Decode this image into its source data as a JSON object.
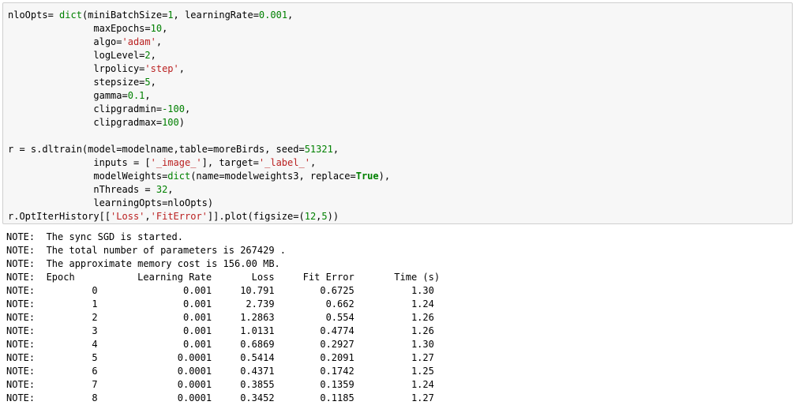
{
  "code_lines": [
    [
      {
        "t": "nloOpts= "
      },
      {
        "t": "dict",
        "c": "tok-builtin"
      },
      {
        "t": "(miniBatchSize="
      },
      {
        "t": "1",
        "c": "tok-num"
      },
      {
        "t": ", learningRate="
      },
      {
        "t": "0.001",
        "c": "tok-num"
      },
      {
        "t": ","
      }
    ],
    [
      {
        "t": "               maxEpochs="
      },
      {
        "t": "10",
        "c": "tok-num"
      },
      {
        "t": ","
      }
    ],
    [
      {
        "t": "               algo="
      },
      {
        "t": "'adam'",
        "c": "tok-str"
      },
      {
        "t": ","
      }
    ],
    [
      {
        "t": "               logLevel="
      },
      {
        "t": "2",
        "c": "tok-num"
      },
      {
        "t": ","
      }
    ],
    [
      {
        "t": "               lrpolicy="
      },
      {
        "t": "'step'",
        "c": "tok-str"
      },
      {
        "t": ","
      }
    ],
    [
      {
        "t": "               stepsize="
      },
      {
        "t": "5",
        "c": "tok-num"
      },
      {
        "t": ","
      }
    ],
    [
      {
        "t": "               gamma="
      },
      {
        "t": "0.1",
        "c": "tok-num"
      },
      {
        "t": ","
      }
    ],
    [
      {
        "t": "               clipgradmin="
      },
      {
        "t": "-100",
        "c": "tok-num"
      },
      {
        "t": ","
      }
    ],
    [
      {
        "t": "               clipgradmax="
      },
      {
        "t": "100",
        "c": "tok-num"
      },
      {
        "t": ")"
      }
    ],
    [
      {
        "t": ""
      }
    ],
    [
      {
        "t": "r = s.dltrain(model=modelname,table=moreBirds, seed="
      },
      {
        "t": "51321",
        "c": "tok-num"
      },
      {
        "t": ","
      }
    ],
    [
      {
        "t": "               inputs = ["
      },
      {
        "t": "'_image_'",
        "c": "tok-str"
      },
      {
        "t": "], target="
      },
      {
        "t": "'_label_'",
        "c": "tok-str"
      },
      {
        "t": ","
      }
    ],
    [
      {
        "t": "               modelWeights="
      },
      {
        "t": "dict",
        "c": "tok-builtin"
      },
      {
        "t": "(name=modelweights3, replace="
      },
      {
        "t": "True",
        "c": "tok-kw"
      },
      {
        "t": "),"
      }
    ],
    [
      {
        "t": "               nThreads = "
      },
      {
        "t": "32",
        "c": "tok-num"
      },
      {
        "t": ","
      }
    ],
    [
      {
        "t": "               learningOpts=nloOpts)"
      }
    ],
    [
      {
        "t": "r.OptIterHistory[["
      },
      {
        "t": "'Loss'",
        "c": "tok-str"
      },
      {
        "t": ","
      },
      {
        "t": "'FitError'",
        "c": "tok-str"
      },
      {
        "t": "]].plot(figsize=("
      },
      {
        "t": "12",
        "c": "tok-num"
      },
      {
        "t": ","
      },
      {
        "t": "5",
        "c": "tok-num"
      },
      {
        "t": "))"
      }
    ]
  ],
  "output_lines": [
    "NOTE:  The sync SGD is started.",
    "NOTE:  The total number of parameters is 267429 .",
    "NOTE:  The approximate memory cost is 156.00 MB.",
    "NOTE:  Epoch           Learning Rate       Loss     Fit Error       Time (s)",
    "NOTE:          0               0.001     10.791        0.6725          1.30",
    "NOTE:          1               0.001      2.739         0.662          1.24",
    "NOTE:          2               0.001     1.2863         0.554          1.26",
    "NOTE:          3               0.001     1.0131        0.4774          1.26",
    "NOTE:          4               0.001     0.6869        0.2927          1.30",
    "NOTE:          5              0.0001     0.5414        0.2091          1.27",
    "NOTE:          6              0.0001     0.4371        0.1742          1.25",
    "NOTE:          7              0.0001     0.3855        0.1359          1.24",
    "NOTE:          8              0.0001     0.3452        0.1185          1.27"
  ]
}
